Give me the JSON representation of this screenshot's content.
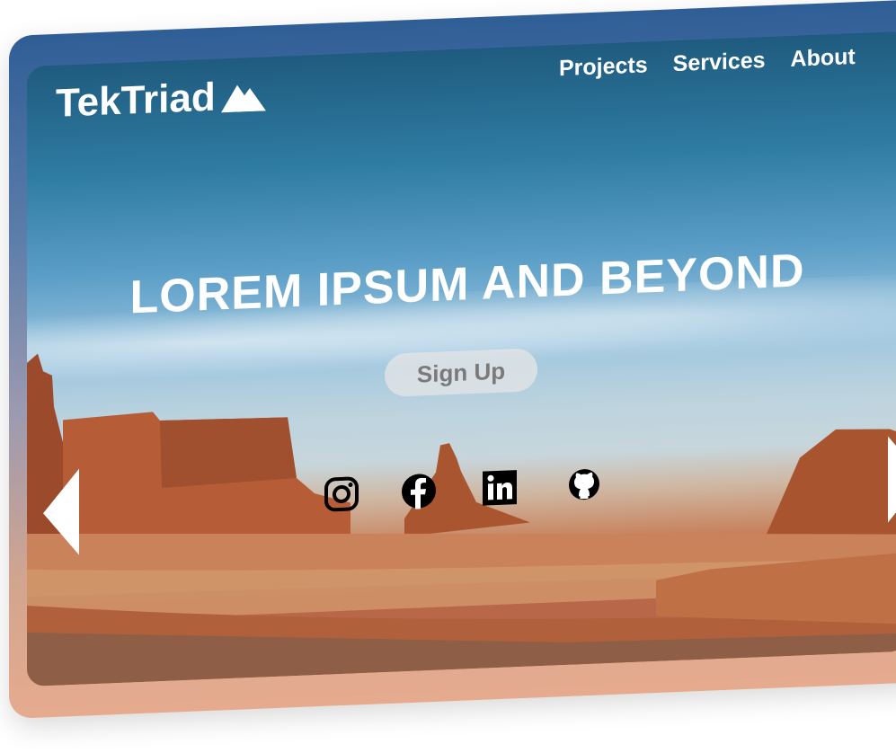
{
  "brand": {
    "name": "TekTriad",
    "icon": "mountain-icon"
  },
  "nav": {
    "items": [
      "Projects",
      "Services",
      "About"
    ]
  },
  "hero": {
    "headline": "LOREM IPSUM AND BEYOND",
    "cta_label": "Sign Up"
  },
  "socials": [
    "instagram-icon",
    "facebook-icon",
    "linkedin-icon",
    "github-icon"
  ],
  "carousel": {
    "prev_icon": "arrow-left-icon",
    "next_icon": "arrow-right-icon"
  },
  "colors": {
    "frame_top": "#2f5e96",
    "frame_bottom": "#e6ab8f",
    "text": "#ffffff",
    "button_text": "#7a7a7a"
  }
}
